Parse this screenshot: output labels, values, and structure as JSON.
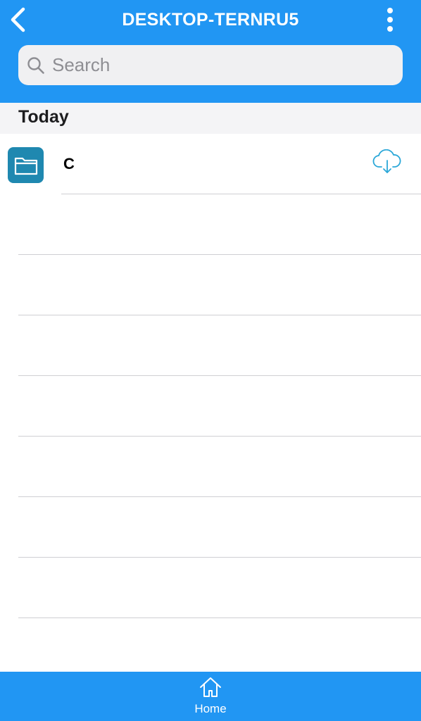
{
  "header": {
    "title": "DESKTOP-TERNRU5",
    "back_icon": "chevron-left-icon",
    "more_icon": "more-vertical-icon",
    "background_color": "#2196f3"
  },
  "search": {
    "placeholder": "Search",
    "value": "",
    "icon": "search-icon"
  },
  "section": {
    "label": "Today"
  },
  "items": [
    {
      "name": "C",
      "icon": "folder-icon",
      "icon_color": "#1f88b0",
      "action_icon": "cloud-download-icon"
    }
  ],
  "tab_bar": {
    "tabs": [
      {
        "label": "Home",
        "icon": "home-icon"
      }
    ]
  }
}
